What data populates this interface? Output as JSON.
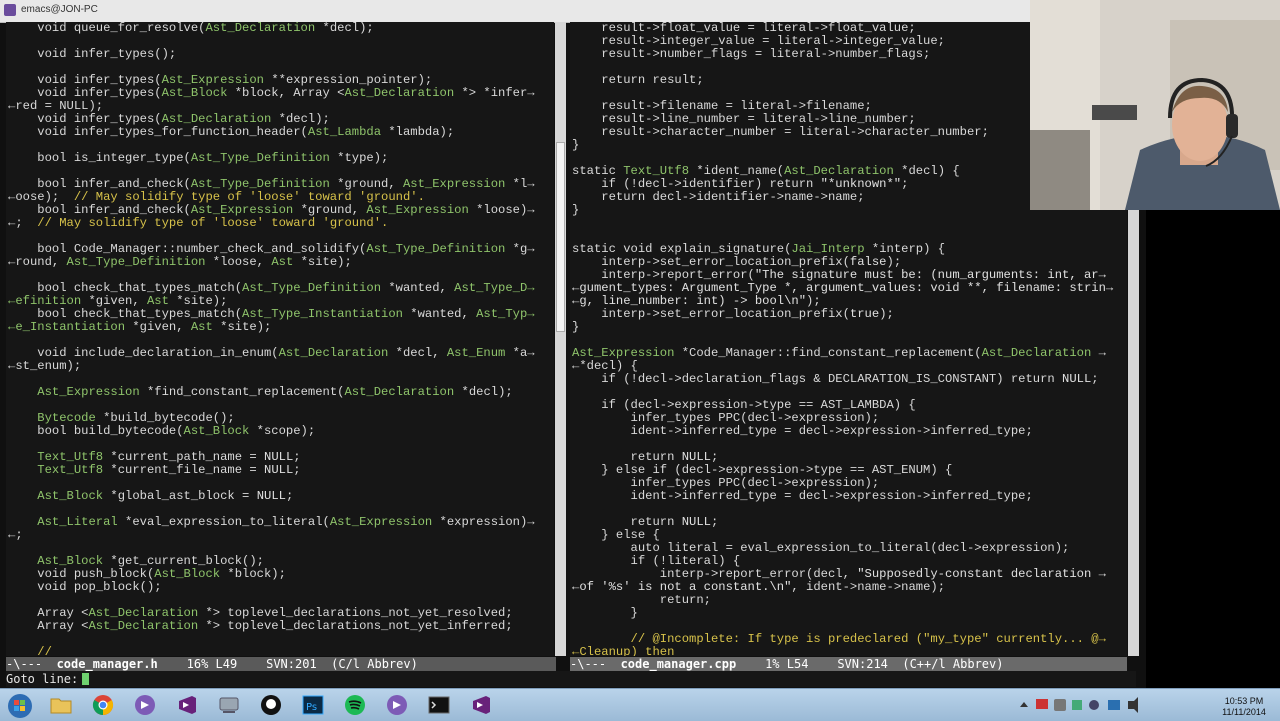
{
  "window": {
    "title": "emacs@JON-PC"
  },
  "left_pane": {
    "lines": [
      [
        [
          "    void queue_for_resolve(",
          "p"
        ],
        [
          "Ast_Declaration",
          "t"
        ],
        [
          " *decl);",
          "p"
        ]
      ],
      [
        [
          "",
          "p"
        ]
      ],
      [
        [
          "    void infer_types();",
          "p"
        ]
      ],
      [
        [
          "",
          "p"
        ]
      ],
      [
        [
          "    void infer_types(",
          "p"
        ],
        [
          "Ast_Expression",
          "t"
        ],
        [
          " **expression_pointer);",
          "p"
        ]
      ],
      [
        [
          "    void infer_types(",
          "p"
        ],
        [
          "Ast_Block",
          "t"
        ],
        [
          " *block, Array <",
          "p"
        ],
        [
          "Ast_Declaration",
          "t"
        ],
        [
          " *> *infer→",
          "p"
        ]
      ],
      [
        [
          "←red = NULL);",
          "p"
        ]
      ],
      [
        [
          "    void infer_types(",
          "p"
        ],
        [
          "Ast_Declaration",
          "t"
        ],
        [
          " *decl);",
          "p"
        ]
      ],
      [
        [
          "    void infer_types_for_function_header(",
          "p"
        ],
        [
          "Ast_Lambda",
          "t"
        ],
        [
          " *lambda);",
          "p"
        ]
      ],
      [
        [
          "",
          "p"
        ]
      ],
      [
        [
          "    bool is_integer_type(",
          "p"
        ],
        [
          "Ast_Type_Definition",
          "t"
        ],
        [
          " *type);",
          "p"
        ]
      ],
      [
        [
          "",
          "p"
        ]
      ],
      [
        [
          "    bool infer_and_check(",
          "p"
        ],
        [
          "Ast_Type_Definition",
          "t"
        ],
        [
          " *ground, ",
          "p"
        ],
        [
          "Ast_Expression",
          "t"
        ],
        [
          " *l→",
          "p"
        ]
      ],
      [
        [
          "←oose);  ",
          "p"
        ],
        [
          "// May solidify type of 'loose' toward 'ground'.",
          "c"
        ]
      ],
      [
        [
          "    bool infer_and_check(",
          "p"
        ],
        [
          "Ast_Expression",
          "t"
        ],
        [
          " *ground, ",
          "p"
        ],
        [
          "Ast_Expression",
          "t"
        ],
        [
          " *loose)→",
          "p"
        ]
      ],
      [
        [
          "←;  ",
          "p"
        ],
        [
          "// May solidify type of 'loose' toward 'ground'.",
          "c"
        ]
      ],
      [
        [
          "",
          "p"
        ]
      ],
      [
        [
          "    bool Code_Manager::number_check_and_solidify(",
          "p"
        ],
        [
          "Ast_Type_Definition",
          "t"
        ],
        [
          " *g→",
          "p"
        ]
      ],
      [
        [
          "←round, ",
          "p"
        ],
        [
          "Ast_Type_Definition",
          "t"
        ],
        [
          " *loose, ",
          "p"
        ],
        [
          "Ast",
          "t"
        ],
        [
          " *site);",
          "p"
        ]
      ],
      [
        [
          "",
          "p"
        ]
      ],
      [
        [
          "    bool check_that_types_match(",
          "p"
        ],
        [
          "Ast_Type_Definition",
          "t"
        ],
        [
          " *wanted, ",
          "p"
        ],
        [
          "Ast_Type_D→",
          "t"
        ]
      ],
      [
        [
          "←efinition",
          "t"
        ],
        [
          " *given, ",
          "p"
        ],
        [
          "Ast",
          "t"
        ],
        [
          " *site);",
          "p"
        ]
      ],
      [
        [
          "    bool check_that_types_match(",
          "p"
        ],
        [
          "Ast_Type_Instantiation",
          "t"
        ],
        [
          " *wanted, ",
          "p"
        ],
        [
          "Ast_Typ→",
          "t"
        ]
      ],
      [
        [
          "←e_Instantiation",
          "t"
        ],
        [
          " *given, ",
          "p"
        ],
        [
          "Ast",
          "t"
        ],
        [
          " *site);",
          "p"
        ]
      ],
      [
        [
          "",
          "p"
        ]
      ],
      [
        [
          "    void include_declaration_in_enum(",
          "p"
        ],
        [
          "Ast_Declaration",
          "t"
        ],
        [
          " *decl, ",
          "p"
        ],
        [
          "Ast_Enum",
          "t"
        ],
        [
          " *a→",
          "p"
        ]
      ],
      [
        [
          "←st_enum);",
          "p"
        ]
      ],
      [
        [
          "",
          "p"
        ]
      ],
      [
        [
          "    ",
          "p"
        ],
        [
          "Ast_Expression",
          "t"
        ],
        [
          " *find_constant_replacement(",
          "p"
        ],
        [
          "Ast_Declaration",
          "t"
        ],
        [
          " *decl);",
          "p"
        ]
      ],
      [
        [
          "",
          "p"
        ]
      ],
      [
        [
          "    ",
          "p"
        ],
        [
          "Bytecode",
          "t"
        ],
        [
          " *build_bytecode();",
          "p"
        ]
      ],
      [
        [
          "    bool build_bytecode(",
          "p"
        ],
        [
          "Ast_Block",
          "t"
        ],
        [
          " *scope);",
          "p"
        ]
      ],
      [
        [
          "",
          "p"
        ]
      ],
      [
        [
          "    ",
          "p"
        ],
        [
          "Text_Utf8",
          "t"
        ],
        [
          " *current_path_name = ",
          "p"
        ],
        [
          "NULL",
          "l"
        ],
        [
          ";",
          "p"
        ]
      ],
      [
        [
          "    ",
          "p"
        ],
        [
          "Text_Utf8",
          "t"
        ],
        [
          " *current_file_name = ",
          "p"
        ],
        [
          "NULL",
          "l"
        ],
        [
          ";",
          "p"
        ]
      ],
      [
        [
          "",
          "p"
        ]
      ],
      [
        [
          "    ",
          "p"
        ],
        [
          "Ast_Block",
          "t"
        ],
        [
          " *global_ast_block = ",
          "p"
        ],
        [
          "NULL",
          "l"
        ],
        [
          ";",
          "p"
        ]
      ],
      [
        [
          "",
          "p"
        ]
      ],
      [
        [
          "    ",
          "p"
        ],
        [
          "Ast_Literal",
          "t"
        ],
        [
          " *eval_expression_to_literal(",
          "p"
        ],
        [
          "Ast_Expression",
          "t"
        ],
        [
          " *expression)→",
          "p"
        ]
      ],
      [
        [
          "←;",
          "p"
        ]
      ],
      [
        [
          "",
          "p"
        ]
      ],
      [
        [
          "    ",
          "p"
        ],
        [
          "Ast_Block",
          "t"
        ],
        [
          " *get_current_block();",
          "p"
        ]
      ],
      [
        [
          "    void push_block(",
          "p"
        ],
        [
          "Ast_Block",
          "t"
        ],
        [
          " *block);",
          "p"
        ]
      ],
      [
        [
          "    void pop_block();",
          "p"
        ]
      ],
      [
        [
          "",
          "p"
        ]
      ],
      [
        [
          "    Array <",
          "p"
        ],
        [
          "Ast_Declaration",
          "t"
        ],
        [
          " *> toplevel_declarations_not_yet_resolved;",
          "p"
        ]
      ],
      [
        [
          "    Array <",
          "p"
        ],
        [
          "Ast_Declaration",
          "t"
        ],
        [
          " *> toplevel_declarations_not_yet_inferred;",
          "p"
        ]
      ],
      [
        [
          "",
          "p"
        ]
      ],
      [
        [
          "    ",
          "p"
        ],
        [
          "//",
          "c"
        ]
      ]
    ]
  },
  "right_pane": {
    "lines": [
      [
        [
          "    result->float_value = literal->float_value;",
          "p"
        ]
      ],
      [
        [
          "    result->integer_value = literal->integer_value;",
          "p"
        ]
      ],
      [
        [
          "    result->number_flags = literal->number_flags;",
          "p"
        ]
      ],
      [
        [
          "",
          "p"
        ]
      ],
      [
        [
          "    return result;",
          "p"
        ]
      ],
      [
        [
          "",
          "p"
        ]
      ],
      [
        [
          "    result->filename = literal->filename;",
          "p"
        ]
      ],
      [
        [
          "    result->line_number = literal->line_number;",
          "p"
        ]
      ],
      [
        [
          "    result->character_number = literal->character_number;",
          "p"
        ]
      ],
      [
        [
          "}",
          "p"
        ]
      ],
      [
        [
          "",
          "p"
        ]
      ],
      [
        [
          "static ",
          "p"
        ],
        [
          "Text_Utf8",
          "t"
        ],
        [
          " *ident_name(",
          "p"
        ],
        [
          "Ast_Declaration",
          "t"
        ],
        [
          " *decl) {",
          "p"
        ]
      ],
      [
        [
          "    if (!decl->identifier) return ",
          "p"
        ],
        [
          "\"*unknown*\"",
          "l"
        ],
        [
          ";",
          "p"
        ]
      ],
      [
        [
          "    return decl->identifier->name->name;",
          "p"
        ]
      ],
      [
        [
          "}",
          "p"
        ]
      ],
      [
        [
          "",
          "p"
        ]
      ],
      [
        [
          "",
          "p"
        ]
      ],
      [
        [
          "static void explain_signature(",
          "p"
        ],
        [
          "Jai_Interp",
          "t"
        ],
        [
          " *interp) {",
          "p"
        ]
      ],
      [
        [
          "    interp->set_error_location_prefix(",
          "p"
        ],
        [
          "false",
          "l"
        ],
        [
          ");",
          "p"
        ]
      ],
      [
        [
          "    interp->report_error(",
          "p"
        ],
        [
          "\"The signature must be: (num_arguments: int, ar→",
          "l"
        ]
      ],
      [
        [
          "←gument_types: Argument_Type *, argument_values: void **, filename: strin→",
          "l"
        ]
      ],
      [
        [
          "←g, line_number: int) -> bool\\n\"",
          "l"
        ],
        [
          ");",
          "p"
        ]
      ],
      [
        [
          "    interp->set_error_location_prefix(",
          "p"
        ],
        [
          "true",
          "l"
        ],
        [
          ");",
          "p"
        ]
      ],
      [
        [
          "}",
          "p"
        ]
      ],
      [
        [
          "",
          "p"
        ]
      ],
      [
        [
          "Ast_Expression",
          "t"
        ],
        [
          " *Code_Manager::find_constant_replacement(",
          "p"
        ],
        [
          "Ast_Declaration",
          "t"
        ],
        [
          " →",
          "p"
        ]
      ],
      [
        [
          "←*decl) {",
          "p"
        ]
      ],
      [
        [
          "    if (!decl->declaration_flags & DECLARATION_IS_CONSTANT) return ",
          "p"
        ],
        [
          "NULL",
          "l"
        ],
        [
          ";",
          "p"
        ]
      ],
      [
        [
          "",
          "p"
        ]
      ],
      [
        [
          "    if (decl->expression->type == AST_LAMBDA) {",
          "p"
        ]
      ],
      [
        [
          "        infer_types PPC(decl->expression);",
          "p"
        ]
      ],
      [
        [
          "        ident->inferred_type = decl->expression->inferred_type;",
          "p"
        ]
      ],
      [
        [
          "",
          "p"
        ]
      ],
      [
        [
          "        return ",
          "p"
        ],
        [
          "NULL",
          "l"
        ],
        [
          ";",
          "p"
        ]
      ],
      [
        [
          "    } else if (decl->expression->type == AST_ENUM) {",
          "p"
        ]
      ],
      [
        [
          "        infer_types PPC(decl->expression);",
          "p"
        ]
      ],
      [
        [
          "        ident->inferred_type = decl->expression->inferred_type;",
          "p"
        ]
      ],
      [
        [
          "",
          "p"
        ]
      ],
      [
        [
          "        return ",
          "p"
        ],
        [
          "NULL",
          "l"
        ],
        [
          ";",
          "p"
        ]
      ],
      [
        [
          "    } else {",
          "p"
        ]
      ],
      [
        [
          "        auto literal = eval_expression_to_literal(decl->expression);",
          "p"
        ]
      ],
      [
        [
          "        if (!literal) {",
          "p"
        ]
      ],
      [
        [
          "            interp->report_error(decl, ",
          "p"
        ],
        [
          "\"Supposedly-constant declaration →",
          "l"
        ]
      ],
      [
        [
          "←of '%s' is not a constant.\\n\"",
          "l"
        ],
        [
          ", ident->name->name);",
          "p"
        ]
      ],
      [
        [
          "            return;",
          "p"
        ]
      ],
      [
        [
          "        }",
          "p"
        ]
      ],
      [
        [
          "",
          "p"
        ]
      ],
      [
        [
          "        ",
          "p"
        ],
        [
          "// @Incomplete: If type is predeclared (\"my_type\" currently... @→",
          "c"
        ]
      ],
      [
        [
          "←Cleanup) then",
          "c"
        ]
      ]
    ]
  },
  "modeline_left": {
    "prefix": "-\\---  ",
    "buffer": "code_manager.h",
    "rest": "    16% L49    SVN:201  (C/l Abbrev)"
  },
  "modeline_right": {
    "prefix": "-\\---  ",
    "buffer": "code_manager.cpp",
    "rest": "    1% L54    SVN:214  (C++/l Abbrev)"
  },
  "minibuffer": {
    "prompt": "Goto line:"
  },
  "taskbar": {
    "items": [
      "start-orb",
      "file-explorer",
      "chrome",
      "visual-studio",
      "visual-studio",
      "network",
      "github",
      "photoshop",
      "spotify",
      "visual-studio",
      "terminal",
      "visual-studio"
    ],
    "clock_time": "10:53 PM",
    "clock_date": "11/11/2014"
  },
  "colors": {
    "type": "#8fc46b",
    "comment": "#d7c24a",
    "text": "#d9d9d9",
    "background": "#161616"
  }
}
